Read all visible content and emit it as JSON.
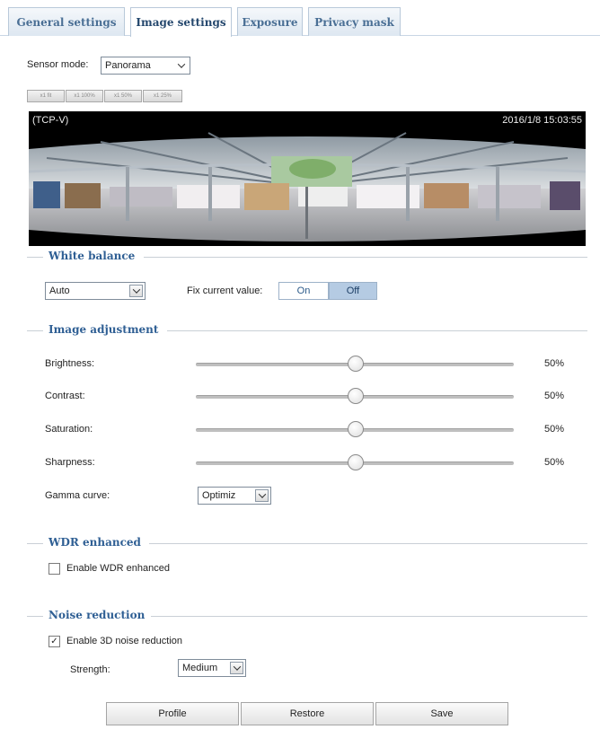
{
  "tabs": [
    {
      "label": "General settings"
    },
    {
      "label": "Image settings"
    },
    {
      "label": "Exposure"
    },
    {
      "label": "Privacy mask"
    }
  ],
  "sensor_mode": {
    "label": "Sensor mode:",
    "value": "Panorama"
  },
  "zoom_buttons": [
    "x1 fit",
    "x1 100%",
    "x1 50%",
    "x1 25%"
  ],
  "viewer": {
    "stream": "(TCP-V)",
    "timestamp": "2016/1/8 15:03:55"
  },
  "white_balance": {
    "title": "White balance",
    "mode": "Auto",
    "fix_label": "Fix current value:",
    "on_label": "On",
    "off_label": "Off"
  },
  "image_adjustment": {
    "title": "Image adjustment",
    "sliders": [
      {
        "label": "Brightness:",
        "value": "50%",
        "fraction": 0.5
      },
      {
        "label": "Contrast:",
        "value": "50%",
        "fraction": 0.5
      },
      {
        "label": "Saturation:",
        "value": "50%",
        "fraction": 0.5
      },
      {
        "label": "Sharpness:",
        "value": "50%",
        "fraction": 0.5
      }
    ],
    "gamma_label": "Gamma curve:",
    "gamma_value": "Optimiz"
  },
  "wdr": {
    "title": "WDR enhanced",
    "checkbox_label": "Enable WDR enhanced",
    "checked": false
  },
  "noise": {
    "title": "Noise reduction",
    "checkbox_label": "Enable 3D noise reduction",
    "checked": true,
    "strength_label": "Strength:",
    "strength_value": "Medium"
  },
  "buttons": {
    "profile": "Profile",
    "restore": "Restore",
    "save": "Save"
  },
  "colors": {
    "tab_text": "#4a6f95",
    "section_title": "#2f5f94",
    "toggle_active": "#b5cbe3"
  }
}
